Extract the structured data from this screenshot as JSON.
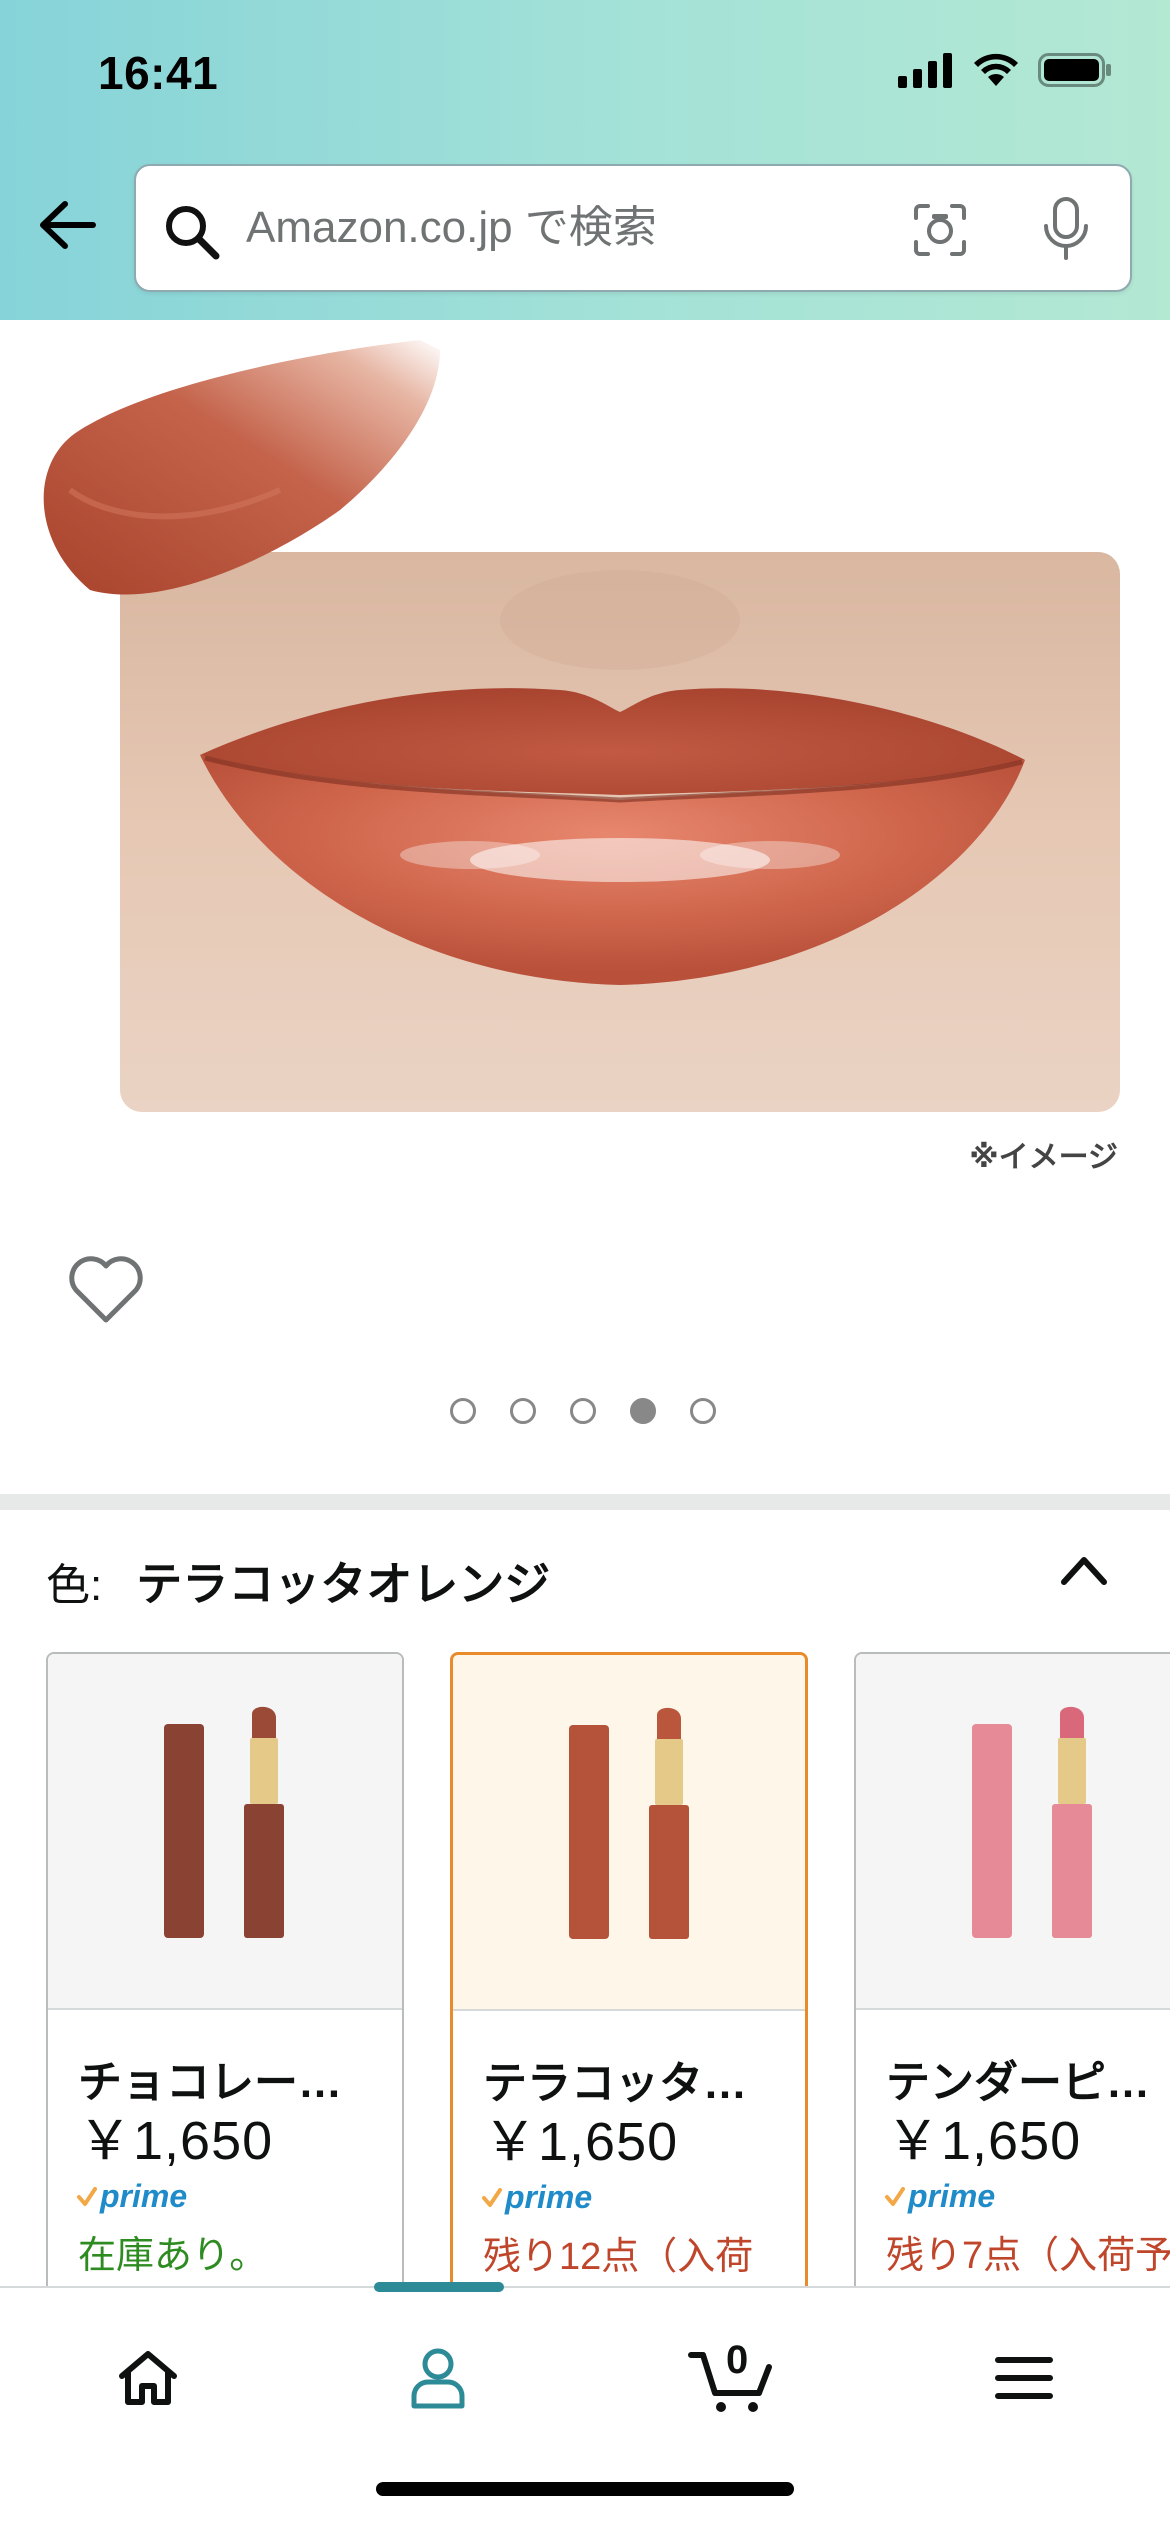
{
  "status_bar": {
    "time": "16:41"
  },
  "search": {
    "placeholder": "Amazon.co.jp で検索"
  },
  "product_image": {
    "note": "※イメージ",
    "pages": 5,
    "active_page": 4
  },
  "color_selector": {
    "label": "色:",
    "selected": "テラコッタオレンジ",
    "options": [
      {
        "name": "チョコレー…",
        "price": "￥1,650",
        "prime": "prime",
        "stock": "在庫あり。",
        "color": "#8a4232",
        "selected": false
      },
      {
        "name": "テラコッタ…",
        "price": "￥1,650",
        "prime": "prime",
        "stock": "残り12点（入荷",
        "color": "#b5533a",
        "selected": true
      },
      {
        "name": "テンダーピ…",
        "price": "￥1,650",
        "prime": "prime",
        "stock": "残り7点（入荷予",
        "color": "#e58a96",
        "selected": false
      }
    ]
  },
  "bottom_nav": {
    "items": [
      "home-icon",
      "account-icon",
      "cart-icon",
      "menu-icon"
    ],
    "cart_count": "0",
    "active": "account-icon"
  },
  "colors": {
    "header_start": "#86d3d9",
    "header_end": "#b3e8d3",
    "accent": "#e98b2a",
    "nav_active": "#2d8b98"
  }
}
